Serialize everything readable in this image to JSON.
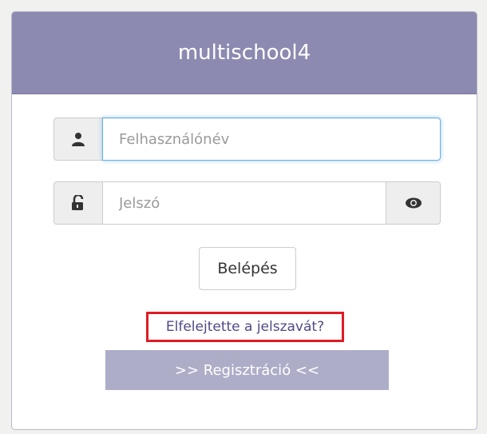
{
  "header": {
    "title": "multischool4"
  },
  "form": {
    "username_placeholder": "Felhasználónév",
    "username_value": "",
    "password_placeholder": "Jelszó",
    "password_value": "",
    "login_label": "Belépés",
    "forgot_label": "Elfelejtette a jelszavát?",
    "register_label": ">> Regisztráció <<"
  },
  "icons": {
    "username": "user-icon",
    "password": "unlock-icon",
    "show_password": "eye-icon"
  },
  "colors": {
    "header_bg": "#8c8ab0",
    "register_bg": "#aeadc8",
    "link": "#4e4a86",
    "highlight_box": "#e01b24",
    "focus_border": "#66afe9"
  }
}
